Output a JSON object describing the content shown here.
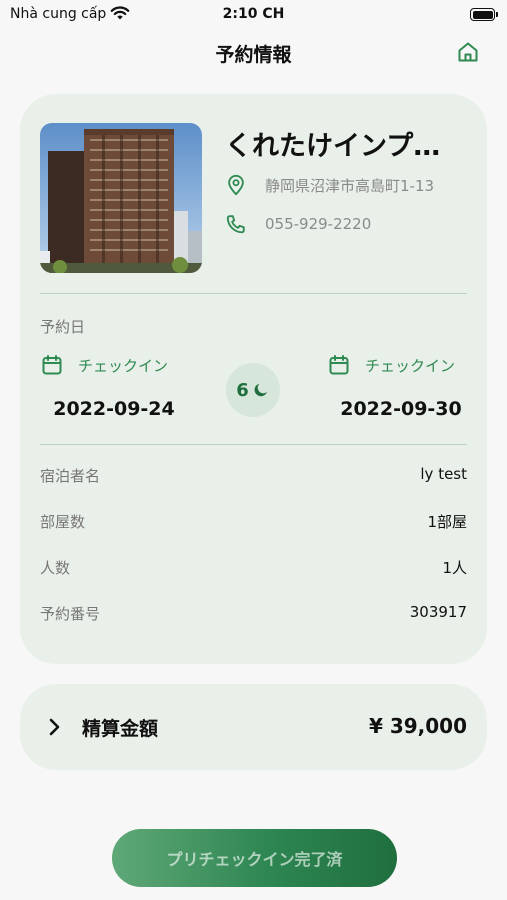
{
  "status_bar": {
    "carrier": "Nhà cung cấp",
    "time": "2:10 CH"
  },
  "header": {
    "title": "予約情報"
  },
  "hotel": {
    "name": "くれたけインプ…",
    "address": "静岡県沼津市高島町1-13",
    "phone": "055-929-2220"
  },
  "stay": {
    "section_label": "予約日",
    "checkin_label": "チェックイン",
    "checkin_date": "2022-09-24",
    "checkout_label": "チェックイン",
    "checkout_date": "2022-09-30",
    "nights": "6"
  },
  "details": [
    {
      "label": "宿泊者名",
      "value": "ly test"
    },
    {
      "label": "部屋数",
      "value": "1部屋"
    },
    {
      "label": "人数",
      "value": "1人"
    },
    {
      "label": "予約番号",
      "value": "303917"
    }
  ],
  "total": {
    "label": "精算金額",
    "value": "¥ 39,000"
  },
  "cta": {
    "label": "プリチェックイン完了済"
  },
  "colors": {
    "accent": "#2f8a52",
    "card_bg": "#e9efe9",
    "divider": "#b7d3bf"
  },
  "icons": [
    "wifi-icon",
    "battery-icon",
    "home-icon",
    "location-pin-icon",
    "phone-icon",
    "calendar-icon",
    "moon-icon",
    "chevron-right-icon"
  ]
}
